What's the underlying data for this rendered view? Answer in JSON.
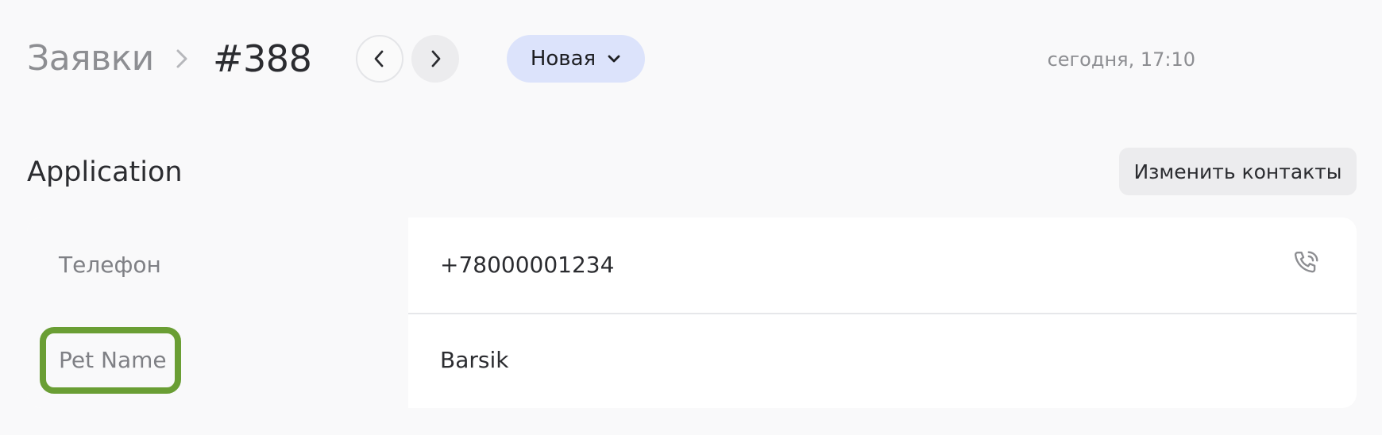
{
  "header": {
    "breadcrumb_root": "Заявки",
    "title": "#388",
    "status": "Новая",
    "timestamp": "сегодня, 17:10",
    "icons": {
      "separator": "chevron-right-icon",
      "prev": "chevron-left-icon",
      "next": "chevron-right-icon",
      "status_dropdown": "chevron-down-icon"
    }
  },
  "section": {
    "title": "Application",
    "edit_button": "Изменить контакты"
  },
  "fields": [
    {
      "label": "Телефон",
      "value": "+78000001234",
      "icon": "phone-call-icon"
    },
    {
      "label": "Pet Name",
      "value": "Barsik"
    }
  ],
  "colors": {
    "background": "#f9f9fa",
    "status_pill": "#dce3fb",
    "highlight": "#6a9e34",
    "muted_text": "#8d8e92"
  }
}
